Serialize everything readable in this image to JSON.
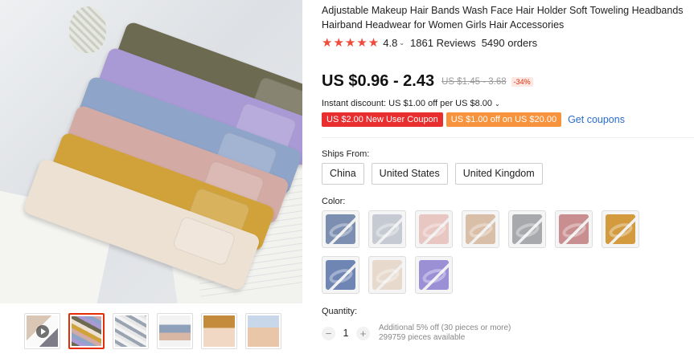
{
  "product": {
    "title": "Adjustable Makeup Hair Bands Wash Face Hair Holder Soft Toweling Headbands Hairband Headwear for Women Girls Hair Accessories",
    "rating_stars": "★★★★★",
    "rating_value": "4.8",
    "reviews": "1861 Reviews",
    "orders": "5490 orders"
  },
  "price": {
    "current": "US $0.96 - 2.43",
    "original": "US $1.45 - 3.68",
    "discount_pct": "-34%"
  },
  "discount": {
    "instant": "Instant discount: US $1.00 off per US $8.00",
    "coupons": [
      "US $2.00 New User Coupon",
      "US $1.00 off on US $20.00"
    ],
    "get_coupons": "Get coupons"
  },
  "ships_from": {
    "label": "Ships From:",
    "options": [
      "China",
      "United States",
      "United Kingdom"
    ]
  },
  "color": {
    "label": "Color:",
    "swatches": [
      {
        "name": "swatch-denim-blue",
        "color": "#7d8fb0"
      },
      {
        "name": "swatch-light-grey",
        "color": "#c6cbd3"
      },
      {
        "name": "swatch-pale-pink",
        "color": "#e8c6c2"
      },
      {
        "name": "swatch-beige",
        "color": "#d9bfa8"
      },
      {
        "name": "swatch-grey",
        "color": "#a7a9ad"
      },
      {
        "name": "swatch-dusty-pink",
        "color": "#c98f90"
      },
      {
        "name": "swatch-mustard",
        "color": "#d39a3e"
      },
      {
        "name": "swatch-blue",
        "color": "#6f86b5"
      },
      {
        "name": "swatch-cream",
        "color": "#e7d9cb"
      },
      {
        "name": "swatch-purple",
        "color": "#9b8fd6"
      }
    ]
  },
  "quantity": {
    "label": "Quantity:",
    "value": "1",
    "minus": "−",
    "plus": "+",
    "note": "Additional 5% off (30 pieces or more)",
    "available": "299759 pieces available"
  },
  "gallery": {
    "thumbnails": [
      "video",
      "headbands-stack",
      "headbands-rolled",
      "headbands-flat",
      "model-mustard",
      "model-wearing"
    ],
    "active_index": 1
  }
}
